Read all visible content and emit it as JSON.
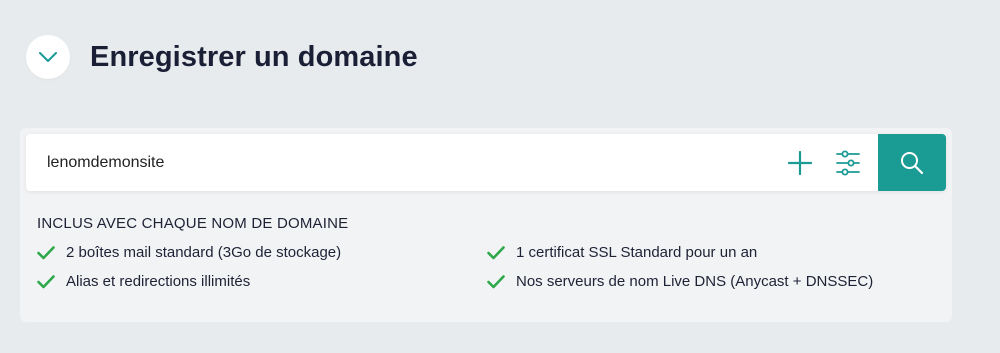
{
  "header": {
    "title": "Enregistrer un domaine",
    "toggle_icon": "chevron-down-icon"
  },
  "search": {
    "value": "lenomdemonsite",
    "add_icon": "plus-icon",
    "filter_icon": "sliders-icon",
    "search_icon": "search-icon"
  },
  "included": {
    "title": "INCLUS AVEC CHAQUE NOM DE DOMAINE",
    "features": [
      "2 boîtes mail standard (3Go de stockage)",
      "1 certificat SSL Standard pour un an",
      "Alias et redirections illimités",
      "Nos serveurs de nom Live DNS (Anycast + DNSSEC)"
    ]
  },
  "colors": {
    "accent": "#1a9b94",
    "check": "#2ea84a",
    "background": "#e7ebed"
  }
}
